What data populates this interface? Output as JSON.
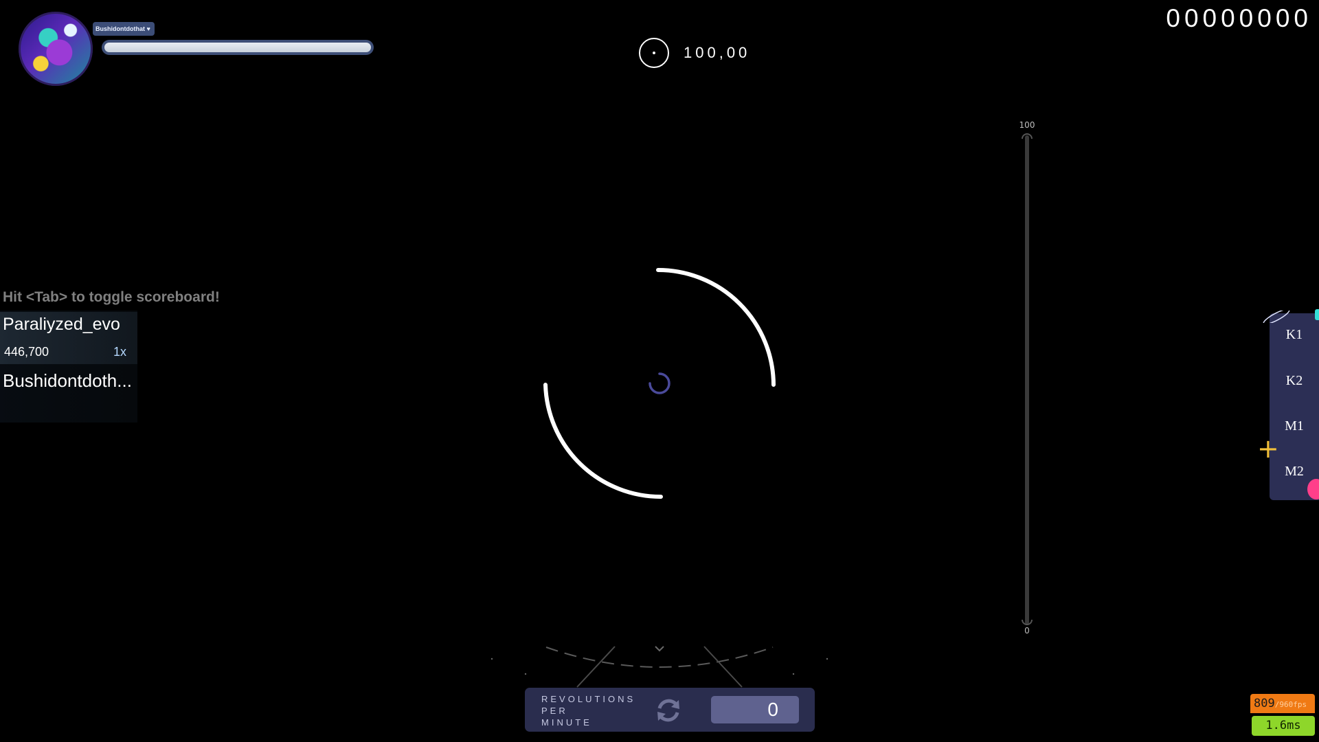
{
  "player": {
    "username": "Bushidontdothat",
    "health_fraction": 1.0
  },
  "hud": {
    "accuracy": "100,00",
    "score": "00000000"
  },
  "scoreboard": {
    "hint": "Hit <Tab> to toggle scoreboard!",
    "entries": [
      {
        "name": "Paraliyzed_evo",
        "score": "446,700",
        "combo": "1x"
      },
      {
        "name": "Bushidontdoth..."
      }
    ]
  },
  "progress_gauge": {
    "max_label": "100",
    "min_label": "0",
    "fraction": 0.0
  },
  "spinner": {
    "rpm_label": "REVOLUTIONS\nPER\nMINUTE",
    "rpm_value": "0"
  },
  "key_overlay": {
    "keys": [
      "K1",
      "K2",
      "M1",
      "M2"
    ]
  },
  "performance": {
    "fps": "809",
    "fps_max": "/960fps",
    "frametime": "1.6ms"
  },
  "colors": {
    "background": "#000000",
    "panel": "#2a2d4e",
    "fps_warn": "#f07a14",
    "frametime_ok": "#8ed62a"
  }
}
